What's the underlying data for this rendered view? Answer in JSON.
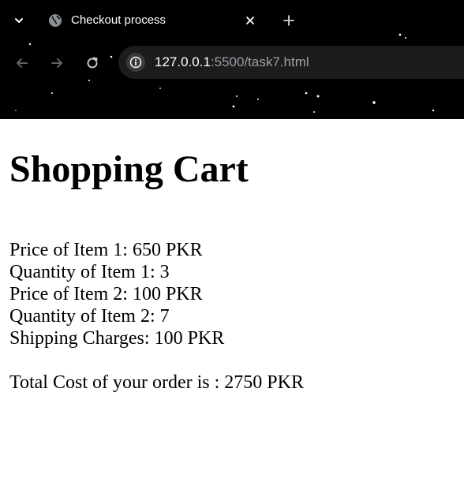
{
  "browser": {
    "tab": {
      "title": "Checkout process",
      "favicon": "globe-icon"
    },
    "address_bar": {
      "host": "127.0.0.1",
      "rest": ":5500/task7.html"
    },
    "icons": {
      "tab_menu": "chevron-down-icon",
      "close_tab": "close-icon",
      "new_tab": "plus-icon",
      "back": "back-arrow-icon",
      "forward": "forward-arrow-icon",
      "reload": "reload-icon",
      "site_info": "info-icon"
    },
    "colors": {
      "chrome_background": "#000000",
      "omnibox_background": "#1c1c1c",
      "url_host": "#ffffff",
      "url_rest": "#9aa0a6"
    }
  },
  "page": {
    "heading": "Shopping Cart",
    "lines": [
      "Price of Item 1: 650 PKR",
      "Quantity of Item 1: 3",
      "Price of Item 2: 100 PKR",
      "Quantity of Item 2: 7",
      "Shipping Charges: 100 PKR"
    ],
    "total": "Total Cost of your order is : 2750 PKR"
  }
}
